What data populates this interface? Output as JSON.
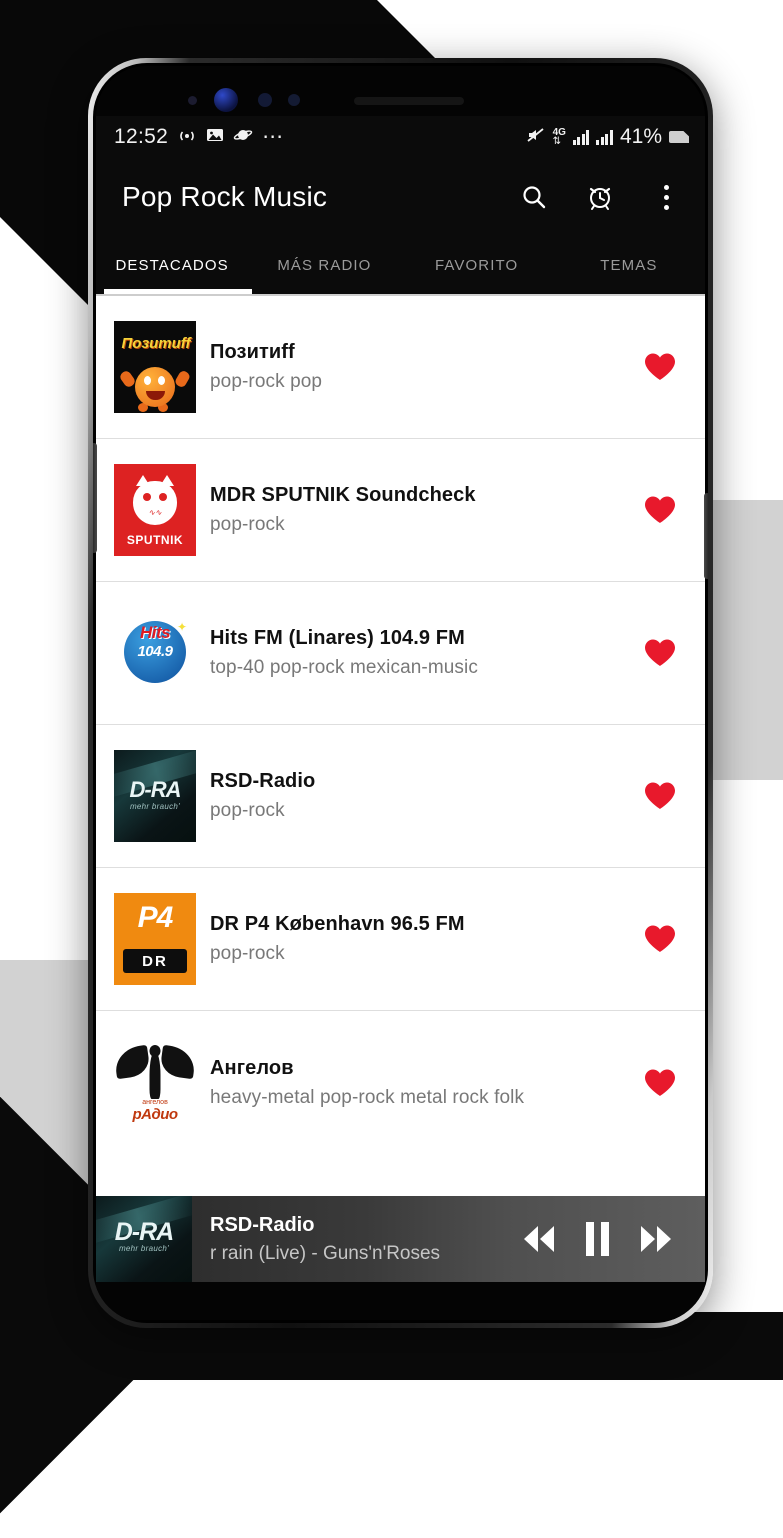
{
  "statusbar": {
    "time": "12:52",
    "battery_percent": "41%",
    "network_type": "4G",
    "icons": [
      "signal-waves-icon",
      "image-icon",
      "planet-icon",
      "more-dots-icon",
      "mute-icon",
      "data-transfer-icon",
      "signal-bars-icon",
      "signal-bars-icon",
      "battery-icon"
    ]
  },
  "appbar": {
    "title": "Pop Rock Music",
    "actions": [
      {
        "name": "search-icon",
        "label": "Search"
      },
      {
        "name": "alarm-icon",
        "label": "Sleep timer"
      },
      {
        "name": "overflow-menu-icon",
        "label": "More options"
      }
    ]
  },
  "tabs": {
    "items": [
      {
        "label": "DESTACADOS",
        "active": true
      },
      {
        "label": "MÁS RADIO",
        "active": false
      },
      {
        "label": "FAVORITO",
        "active": false
      },
      {
        "label": "TEMAS",
        "active": false
      }
    ]
  },
  "stations": [
    {
      "name": "Позитиff",
      "tags": "pop-rock  pop",
      "logo_text": "Позитиff",
      "favorite": true
    },
    {
      "name": "MDR SPUTNIK Soundcheck",
      "tags": "pop-rock",
      "logo_text": "SPUTNIK",
      "favorite": true
    },
    {
      "name": "Hits FM (Linares) 104.9 FM",
      "tags": "top-40  pop-rock  mexican-music",
      "logo_text": "Hits",
      "logo_number": "104.9",
      "favorite": true
    },
    {
      "name": "RSD-Radio",
      "tags": "pop-rock",
      "logo_text": "D-RA",
      "logo_sub": "mehr brauch'",
      "favorite": true
    },
    {
      "name": "DR P4 København 96.5 FM",
      "tags": "pop-rock",
      "logo_text": "P4",
      "logo_sub": "DR",
      "favorite": true
    },
    {
      "name": "Ангелов",
      "tags": "heavy-metal  pop-rock  metal  rock  folk",
      "logo_text": "рАдио",
      "logo_sub": "ангелов",
      "favorite": true
    }
  ],
  "player": {
    "station": "RSD-Radio",
    "track": "r rain (Live) - Guns'n'Roses",
    "logo_text": "D-RA",
    "logo_sub": "mehr brauch'",
    "controls": [
      {
        "name": "previous-icon",
        "label": "Previous"
      },
      {
        "name": "pause-icon",
        "label": "Pause"
      },
      {
        "name": "next-icon",
        "label": "Next"
      }
    ]
  },
  "colors": {
    "heart_red": "#E8192C",
    "appbar_bg": "#0B0B0B",
    "sputnik_red": "#DD2222",
    "p4_orange": "#F08A10",
    "hits_blue": "#0E4F9C"
  }
}
